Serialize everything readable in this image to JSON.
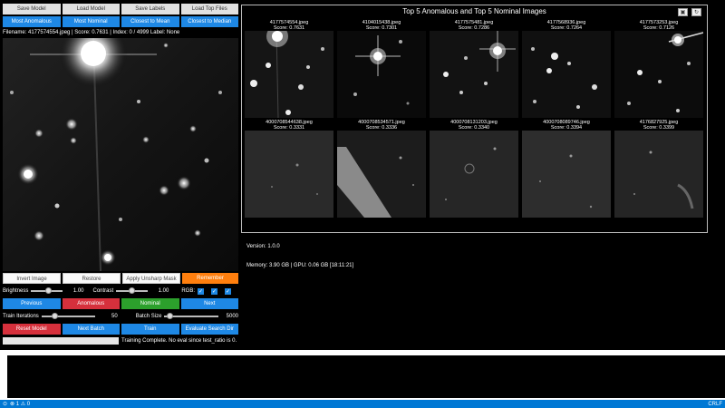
{
  "toolbar": {
    "save_model": "Save Model",
    "load_model": "Load Model",
    "save_labels": "Save Labels",
    "load_top_files": "Load Top Files",
    "most_anomalous": "Most Anomalous",
    "most_nominal": "Most Nominal",
    "closest_to_mean": "Closest to Mean",
    "closest_to_median": "Closest to Median"
  },
  "file_info": "Filename: 4177574554.jpeg | Score: 0.7631 | Index: 0 / 4999   Label: None",
  "image_tools": {
    "invert": "Invert Image",
    "restore": "Restore",
    "unsharp": "Apply Unsharp Mask",
    "remember": "Remember"
  },
  "adjust": {
    "brightness_label": "Brightness",
    "brightness_value": "1.00",
    "brightness_level": 0.55,
    "contrast_label": "Contrast",
    "contrast_value": "1.00",
    "contrast_level": 0.5,
    "rgb_label": "RGB:",
    "rgb_checks": [
      "✓",
      "✓",
      "✓"
    ]
  },
  "nav": {
    "previous": "Previous",
    "anomalous": "Anomalous",
    "nominal": "Nominal",
    "next": "Next"
  },
  "train": {
    "iterations_label": "Train Iterations",
    "iterations_value": "50",
    "iterations_level": 0.25,
    "batch_label": "Batch Size",
    "batch_value": "5000",
    "batch_level": 0.1
  },
  "actions": {
    "reset_model": "Reset Model",
    "next_batch": "Next Batch",
    "train": "Train",
    "evaluate": "Evaluate Search Dir"
  },
  "status": {
    "progress": 1.0,
    "message": "Training Complete. No eval since test_ratio is 0."
  },
  "gallery": {
    "title": "Top 5 Anomalous and Top 5 Nominal Images",
    "icons": [
      "save-icon",
      "refresh-icon"
    ],
    "anomalous": [
      {
        "file": "4177574554.jpeg",
        "score": "Score: 0.7631"
      },
      {
        "file": "4104015438.jpeg",
        "score": "Score: 0.7301"
      },
      {
        "file": "4177575481.jpeg",
        "score": "Score: 0.7286"
      },
      {
        "file": "4177568936.jpeg",
        "score": "Score: 0.7264"
      },
      {
        "file": "4177573253.jpeg",
        "score": "Score: 0.7126"
      }
    ],
    "nominal": [
      {
        "file": "4000708544638.jpeg",
        "score": "Score: 0.3331"
      },
      {
        "file": "4000708534571.jpeg",
        "score": "Score: 0.3336"
      },
      {
        "file": "4000708131203.jpeg",
        "score": "Score: 0.3340"
      },
      {
        "file": "4000708089746.jpeg",
        "score": "Score: 0.3394"
      },
      {
        "file": "4176827925.jpeg",
        "score": "Score: 0.3399"
      }
    ]
  },
  "info": {
    "version": "Version: 1.0.0",
    "memory": "Memory: 3.90 GB | GPU: 0.06 GB [18:11:21]"
  },
  "statusbar": {
    "remote_icon": "remote-icon",
    "problems": "⊗ 1 ⚠ 0",
    "right": "CRLF"
  },
  "colors": {
    "blue": "#1e88e5",
    "orange": "#ff7f0e",
    "red": "#d6303c",
    "green": "#2ca02c",
    "statusbar": "#0078d4"
  }
}
